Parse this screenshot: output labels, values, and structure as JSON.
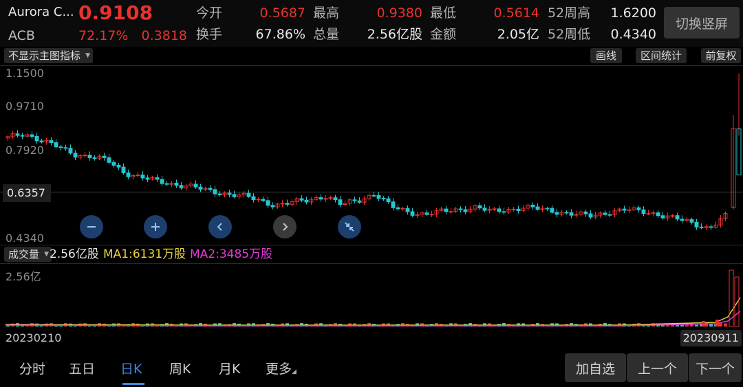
{
  "header": {
    "name": "Aurora C...",
    "ticker": "ACB",
    "price": "0.9108",
    "change_pct": "72.17%",
    "change_amt": "0.3818",
    "open_label": "今开",
    "open_value": "0.5687",
    "high_label": "最高",
    "high_value": "0.9380",
    "low_label": "最低",
    "low_value": "0.5614",
    "w52_high_label": "52周高",
    "w52_high_value": "1.6200",
    "turnover_label": "换手",
    "turnover_value": "67.86%",
    "volume_label": "总量",
    "volume_value": "2.56亿股",
    "amount_label": "金额",
    "amount_value": "2.05亿",
    "w52_low_label": "52周低",
    "w52_low_value": "0.4340",
    "switch_label": "切换竖屏"
  },
  "toolbar": {
    "indicator_select": "不显示主图指标",
    "draw_label": "画线",
    "range_label": "区间统计",
    "adjust_label": "前复权"
  },
  "chart": {
    "y_labels": [
      "1.1500",
      "0.9710",
      "0.7920",
      "0.4340"
    ],
    "current_label": "0.6357",
    "controls": [
      "zoom-out",
      "zoom-in",
      "prev",
      "next",
      "collapse"
    ]
  },
  "volume": {
    "select": "成交量",
    "total": "2.56亿股",
    "ma1": "MA1:6131万股",
    "ma2": "MA2:3485万股",
    "max_label": "2.56亿"
  },
  "dates": {
    "start": "20230210",
    "end": "20230911"
  },
  "tabs": [
    "分时",
    "五日",
    "日K",
    "周K",
    "月K",
    "更多"
  ],
  "active_tab": "日K",
  "buttons": {
    "add": "加自选",
    "prev": "上一个",
    "next": "下一个"
  },
  "colors": {
    "up": "#e8322e",
    "down": "#25c7cf",
    "accent": "#3f86e0",
    "ma1": "#e8d23a",
    "ma2": "#e23bd6"
  },
  "chart_data": {
    "type": "candlestick",
    "ylim": [
      0.434,
      1.15
    ],
    "x_range": [
      "20230210",
      "20230911"
    ],
    "close_trend": [
      0.87,
      0.89,
      0.86,
      0.83,
      0.8,
      0.79,
      0.77,
      0.72,
      0.7,
      0.68,
      0.67,
      0.66,
      0.64,
      0.63,
      0.62,
      0.6,
      0.58,
      0.59,
      0.6,
      0.62,
      0.58,
      0.6,
      0.63,
      0.57,
      0.55,
      0.54,
      0.55,
      0.56,
      0.57,
      0.55,
      0.56,
      0.57,
      0.56,
      0.55,
      0.54,
      0.53,
      0.55,
      0.56,
      0.55,
      0.54,
      0.52,
      0.5,
      0.48,
      0.53,
      0.91
    ],
    "last_close": 0.9108,
    "current_line": 0.6357
  }
}
